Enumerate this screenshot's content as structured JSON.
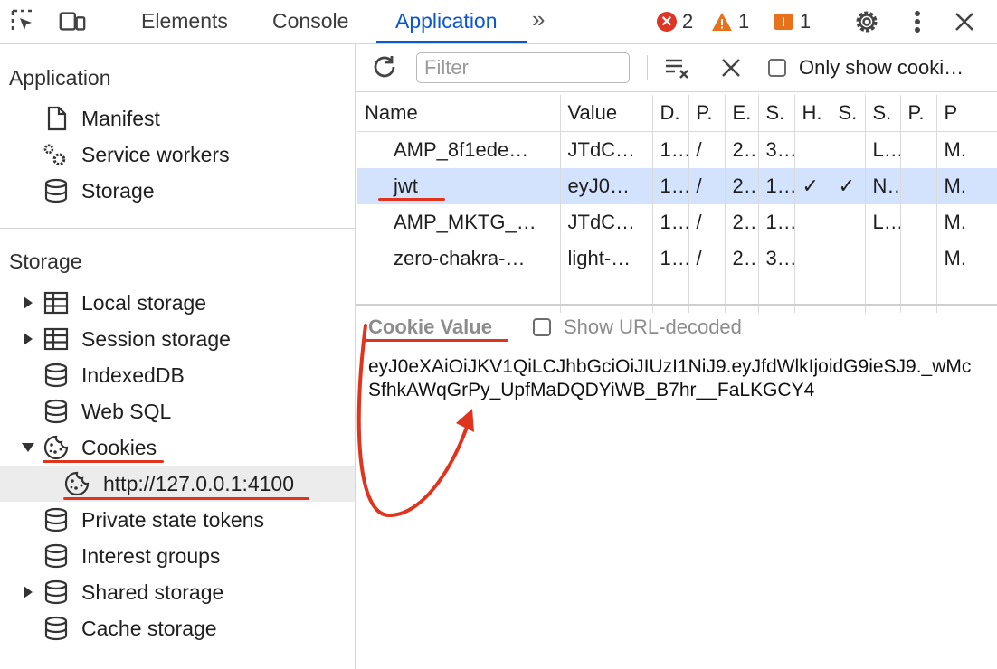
{
  "toolbar": {
    "tabs": [
      "Elements",
      "Console",
      "Application"
    ],
    "more_tabs": "»",
    "errors": "2",
    "warnings": "1",
    "issues": "1",
    "icons": [
      "inspect-icon",
      "device-toolbar-icon",
      "settings-gear-icon",
      "more-vert-icon",
      "close-icon"
    ]
  },
  "sidebar": {
    "application_title": "Application",
    "application_items": [
      {
        "label": "Manifest",
        "icon": "document-icon"
      },
      {
        "label": "Service workers",
        "icon": "gears-icon"
      },
      {
        "label": "Storage",
        "icon": "database-icon"
      }
    ],
    "storage_title": "Storage",
    "storage_items": [
      {
        "label": "Local storage",
        "icon": "table-icon",
        "expand": "collapsed"
      },
      {
        "label": "Session storage",
        "icon": "table-icon",
        "expand": "collapsed"
      },
      {
        "label": "IndexedDB",
        "icon": "database-icon",
        "expand": "none"
      },
      {
        "label": "Web SQL",
        "icon": "database-icon",
        "expand": "none"
      },
      {
        "label": "Cookies",
        "icon": "cookie-icon",
        "expand": "expanded"
      },
      {
        "label": "http://127.0.0.1:4100",
        "icon": "cookie-icon",
        "expand": "none",
        "selected": true
      },
      {
        "label": "Private state tokens",
        "icon": "database-icon",
        "expand": "none"
      },
      {
        "label": "Interest groups",
        "icon": "database-icon",
        "expand": "none"
      },
      {
        "label": "Shared storage",
        "icon": "database-icon",
        "expand": "collapsed"
      },
      {
        "label": "Cache storage",
        "icon": "database-icon",
        "expand": "none"
      }
    ]
  },
  "cookie_toolbar": {
    "filter_placeholder": "Filter",
    "only_show_label": "Only show cooki…"
  },
  "cookie_table": {
    "headers": [
      "Name",
      "Value",
      "D.",
      "P.",
      "E.",
      "S.",
      "H.",
      "S.",
      "S.",
      "P.",
      "P"
    ],
    "rows": [
      [
        "AMP_8f1ede…",
        "JTdC…",
        "1…",
        "/",
        "2…",
        "3…",
        "",
        "",
        "L…",
        "",
        "M."
      ],
      [
        "jwt",
        "eyJ0…",
        "1…",
        "/",
        "2…",
        "1…",
        "✓",
        "✓",
        "N…",
        "",
        "M."
      ],
      [
        "AMP_MKTG_…",
        "JTdC…",
        "1…",
        "/",
        "2…",
        "1…",
        "",
        "",
        "L…",
        "",
        "M."
      ],
      [
        "zero-chakra-…",
        "light-…",
        "1…",
        "/",
        "2…",
        "3…",
        "",
        "",
        "",
        "",
        "M."
      ]
    ],
    "selected_row": 1
  },
  "cookie_value": {
    "title": "Cookie Value",
    "show_decoded_label": "Show URL-decoded",
    "value": "eyJ0eXAiOiJKV1QiLCJhbGciOiJIUzI1NiJ9.eyJfdWlkIjoidG9ieSJ9._wMcSfhkAWqGrPy_UpfMaDQDYiWB_B7hr__FaLKGCY4"
  },
  "colors": {
    "accent": "#0b57d0",
    "annotation": "#e0341e",
    "selected_row": "#d3e3fd"
  }
}
